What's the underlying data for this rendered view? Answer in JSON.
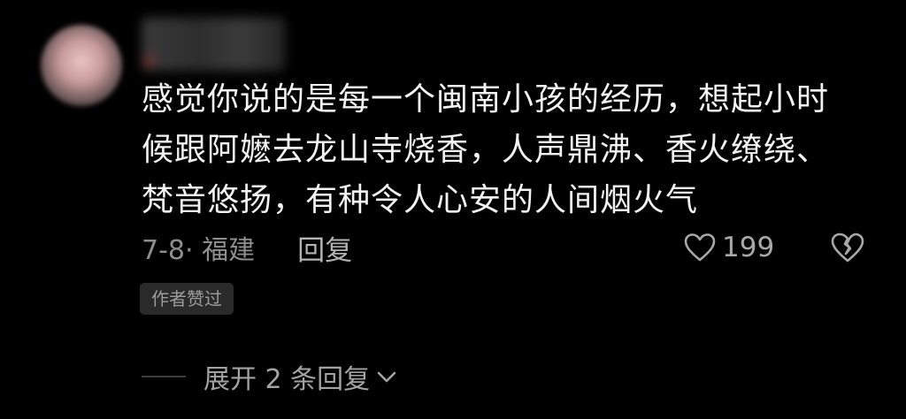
{
  "comment": {
    "text": "感觉你说的是每一个闽南小孩的经历，想起小时候跟阿嬷去龙山寺烧香，人声鼎沸、香火缭绕、梵音悠扬，有种令人心安的人间烟火气",
    "meta": "7-8· 福建",
    "reply_label": "回复",
    "like_count": "199",
    "author_badge": "作者赞过",
    "expand_label": "展开 2 条回复"
  },
  "icons": {
    "like": "heart-outline-icon",
    "dislike": "broken-heart-icon",
    "expand": "chevron-down-icon"
  },
  "colors": {
    "background": "#000000",
    "text": "#f2f2f2",
    "secondary": "#8e8e8e",
    "badge_bg": "#2a2a2a"
  }
}
